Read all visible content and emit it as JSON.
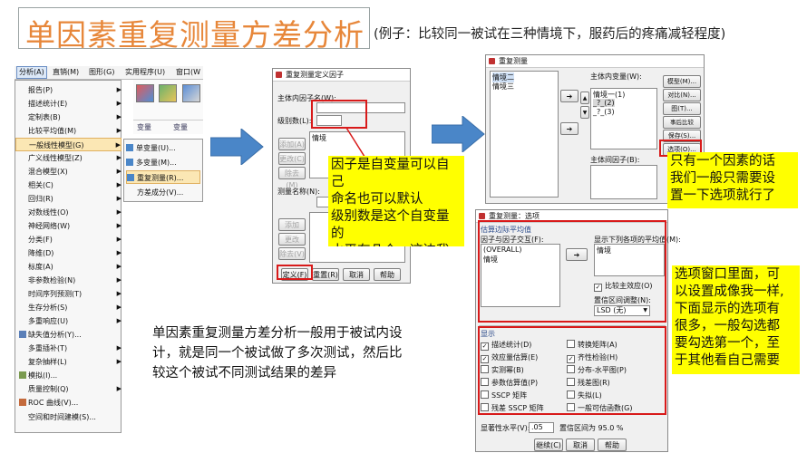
{
  "header": {
    "title": "单因素重复测量方差分析",
    "subtitle": "(例子：比较同一被试在三种情境下，服药后的疼痛减轻程度)"
  },
  "spss_menu": {
    "menubar": [
      "分析(A)",
      "直销(M)",
      "图形(G)",
      "实用程序(U)",
      "窗口(W"
    ],
    "items": [
      "报告(P)",
      "描述统计(E)",
      "定制表(B)",
      "比较平均值(M)",
      "一般线性模型(G)",
      "广义线性模型(Z)",
      "混合模型(X)",
      "相关(C)",
      "回归(R)",
      "对数线性(O)",
      "神经网络(W)",
      "分类(F)",
      "降维(D)",
      "标度(A)",
      "非参数检验(N)",
      "时间序列预测(T)",
      "生存分析(S)",
      "多重响应(U)",
      "缺失值分析(Y)...",
      "多重插补(T)",
      "复杂抽样(L)",
      "模拟(I)...",
      "质量控制(Q)",
      "ROC 曲线(V)...",
      "空间和时间建模(S)..."
    ],
    "submenu": [
      "单变量(U)...",
      "多变量(M)...",
      "重复测量(R)...",
      "方差成分(V)..."
    ],
    "grid_headers": [
      "变量",
      "变量"
    ]
  },
  "define_dialog": {
    "title": "重复测量定义因子",
    "subject_factor_label": "主体内因子名(W):",
    "levels_label": "级别数(L):",
    "list_item": "情境",
    "add": "添加(A)",
    "change": "更改(C)",
    "remove": "除去(M)",
    "measure_label": "测量名称(N):",
    "add2": "添加(D)",
    "change2": "更改(H)",
    "remove2": "除去(V)",
    "define": "定义(F)",
    "reset": "重置(R)",
    "cancel": "取消",
    "help": "帮助"
  },
  "rm_dialog": {
    "title": "重复测量",
    "left_items": [
      "情境二",
      "情境三"
    ],
    "within_label": "主体内变量(W):",
    "within_items": [
      "情境一(1)",
      "_?_(2)",
      "_?_(3)"
    ],
    "between_label": "主体间因子(B):",
    "side_buttons": [
      "模型(M)...",
      "对比(N)...",
      "图(T)...",
      "事后比较(H)...",
      "保存(S)...",
      "选项(O)..."
    ]
  },
  "options_dialog": {
    "title": "重复测量：选项",
    "section": "估算边际平均值",
    "factors_label": "因子与因子交互(F):",
    "factors": [
      "(OVERALL)",
      "情境"
    ],
    "means_label": "显示下列各项的平均值(M):",
    "means": [
      "情境"
    ],
    "compare_main": "比较主效应(O)",
    "ci_label": "置信区间调整(N):",
    "ci_value": "LSD (无)",
    "display_section": "显示",
    "checks": [
      {
        "label": "描述统计(D)",
        "checked": true
      },
      {
        "label": "转换矩阵(A)",
        "checked": false
      },
      {
        "label": "效应量估算(E)",
        "checked": true
      },
      {
        "label": "齐性检验(H)",
        "checked": true
      },
      {
        "label": "实测幂(B)",
        "checked": false
      },
      {
        "label": "分布-水平图(P)",
        "checked": false
      },
      {
        "label": "参数估算值(P)",
        "checked": false
      },
      {
        "label": "残差图(R)",
        "checked": false
      },
      {
        "label": "SSCP 矩阵",
        "checked": false
      },
      {
        "label": "失拟(L)",
        "checked": false
      },
      {
        "label": "残差 SSCP 矩阵",
        "checked": false
      },
      {
        "label": "一般可估函数(G)",
        "checked": false
      }
    ],
    "sig_label": "显著性水平(V):",
    "sig_value": ".05",
    "ci_text": "置信区间为 95.0 %",
    "continue": "继续(C)",
    "cancel": "取消",
    "help": "帮助"
  },
  "notes": {
    "factor_note": "因子是自变量可以自己\n命名也可以默认\n级别数是这个自变量的\n水平有几个，这边我们\n是三种情",
    "options_note": "只有一个因素的话\n我们一般只需要设\n置一下选项就行了",
    "options_window_note": "选项窗口里面，可\n以设置成像我一样,\n下面显示的选项有\n很多，一般勾选都\n要勾选第一个，至\n于其他看自己需要"
  },
  "explanation": [
    "单因素重复测量方差分析一般用于被试内设",
    "计，就是同一个被试做了多次测试，然后比",
    "较这个被试不同测试结果的差异"
  ],
  "colors": {
    "title": "#e7873a",
    "highlight": "#ffff00",
    "red_box": "#d81a1a",
    "arrow": "#4a86c8",
    "menu_selected": "#fbe7b4"
  }
}
